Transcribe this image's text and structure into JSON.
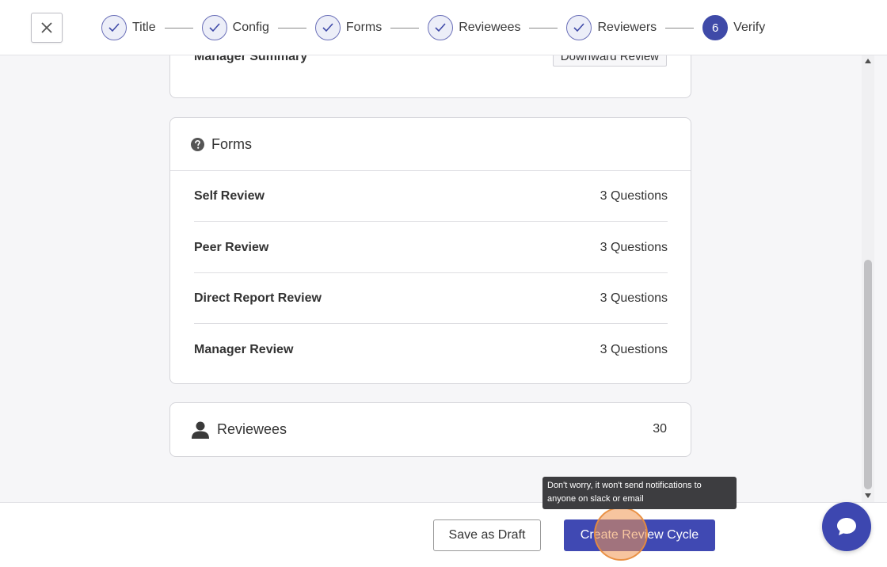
{
  "stepper": {
    "steps": [
      {
        "label": "Title",
        "state": "done"
      },
      {
        "label": "Config",
        "state": "done"
      },
      {
        "label": "Forms",
        "state": "done"
      },
      {
        "label": "Reviewees",
        "state": "done"
      },
      {
        "label": "Reviewers",
        "state": "done"
      },
      {
        "label": "Verify",
        "state": "active",
        "number": "6"
      }
    ]
  },
  "summary": {
    "label": "Manager Summary",
    "tag": "Downward Review"
  },
  "forms": {
    "title": "Forms",
    "rows": [
      {
        "name": "Self Review",
        "count": "3 Questions"
      },
      {
        "name": "Peer Review",
        "count": "3 Questions"
      },
      {
        "name": "Direct Report Review",
        "count": "3 Questions"
      },
      {
        "name": "Manager Review",
        "count": "3 Questions"
      }
    ]
  },
  "reviewees": {
    "title": "Reviewees",
    "count": "30"
  },
  "footer": {
    "draft_label": "Save as Draft",
    "create_label": "Create Review Cycle"
  },
  "tooltip": {
    "text": "Don't worry, it won't send notifications to anyone on slack or email"
  },
  "colors": {
    "primary": "#4049b3",
    "step_done_bg": "#eceef8",
    "tooltip_bg": "#3d3d40"
  }
}
